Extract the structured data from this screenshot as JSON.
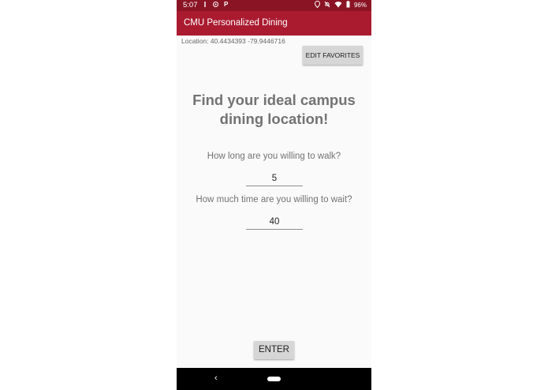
{
  "status_bar": {
    "time": "5:07",
    "left_icons": [
      "notification-icon",
      "settings-icon",
      "parking-icon"
    ],
    "right_icons": [
      "location-icon",
      "silent-icon",
      "wifi-icon",
      "battery-icon"
    ],
    "battery": "96%",
    "parking_glyph": "P"
  },
  "app_bar": {
    "title": "CMU Personalized Dining",
    "color": "#aa1b30"
  },
  "location": {
    "text": "Location: 40.4434393 -79.9446716"
  },
  "buttons": {
    "edit_favorites": "EDIT FAVORITES",
    "enter": "ENTER"
  },
  "main": {
    "headline_line1": "Find your ideal campus",
    "headline_line2": "dining location!",
    "walk_question": "How long are you willing to walk?",
    "walk_value": "5",
    "wait_question": "How much time are you willing to wait?",
    "wait_value": "40"
  },
  "nav_bar": {
    "back_glyph": "‹"
  }
}
